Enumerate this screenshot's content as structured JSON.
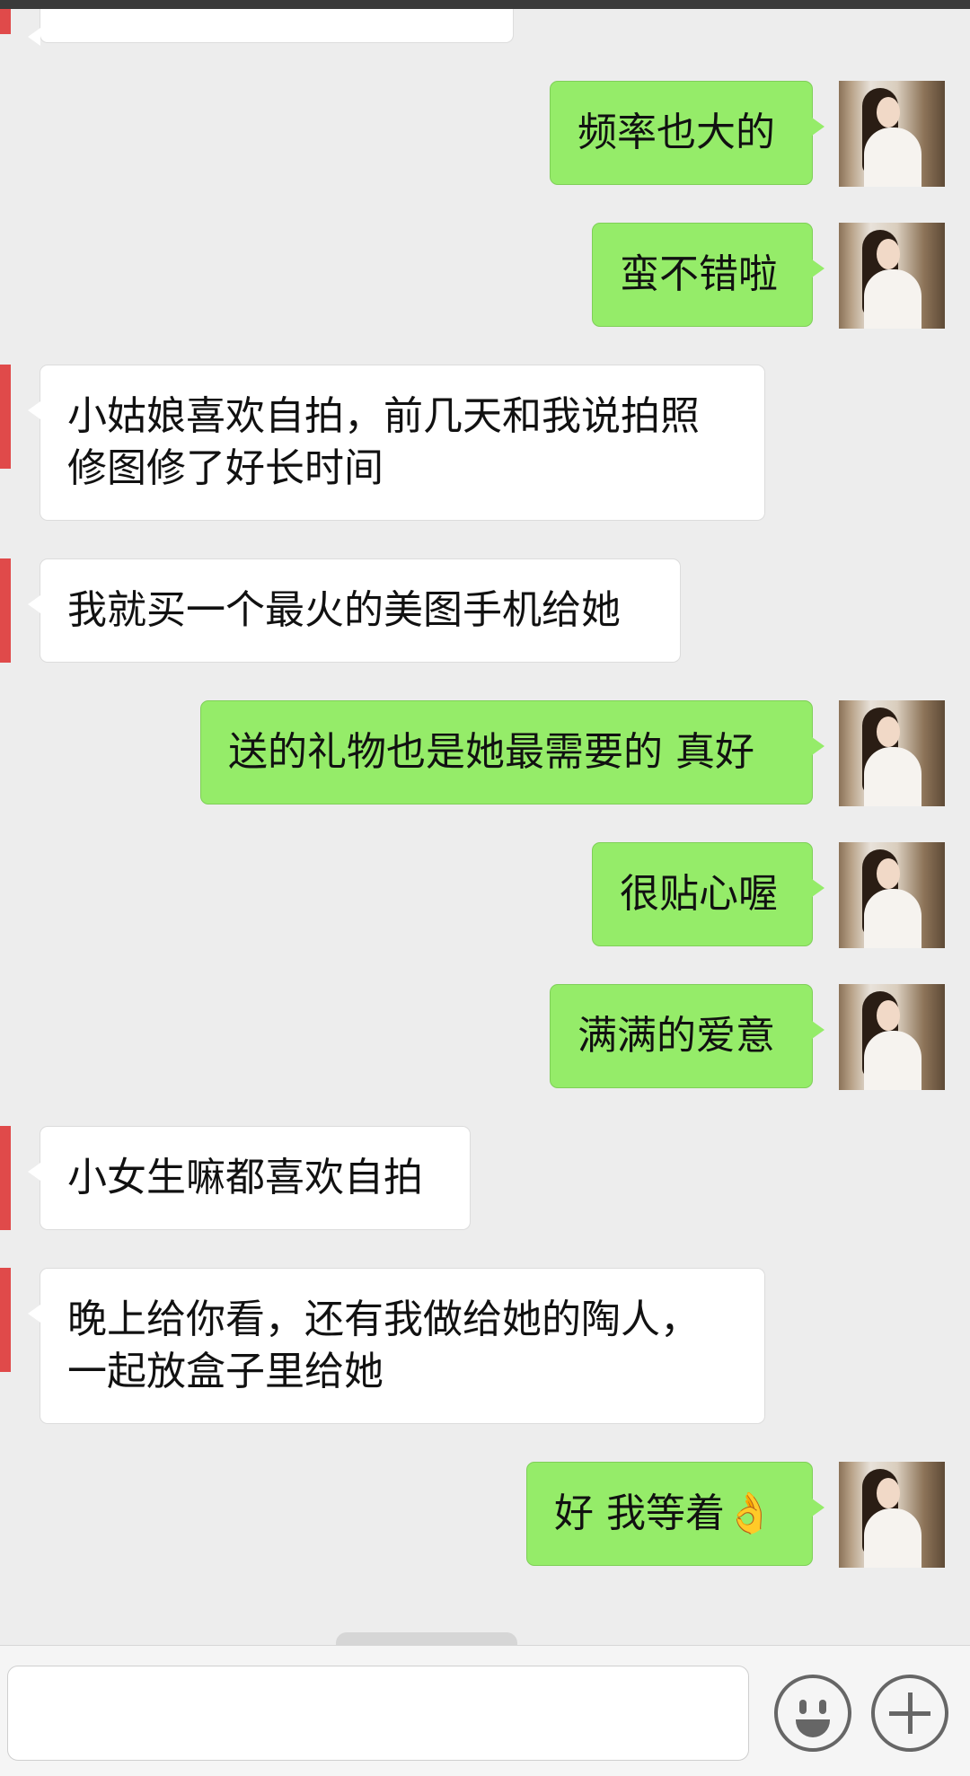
{
  "messages": [
    {
      "side": "out",
      "text": "频率也大的"
    },
    {
      "side": "out",
      "text": "蛮不错啦"
    },
    {
      "side": "in",
      "text": "小姑娘喜欢自拍，前几天和我说拍照\n修图修了好长时间"
    },
    {
      "side": "in",
      "text": "我就买一个最火的美图手机给她"
    },
    {
      "side": "out",
      "text": "送的礼物也是她最需要的 真好"
    },
    {
      "side": "out",
      "text": "很贴心喔"
    },
    {
      "side": "out",
      "text": "满满的爱意"
    },
    {
      "side": "in",
      "text": "小女生嘛都喜欢自拍"
    },
    {
      "side": "in",
      "text": "晚上给你看，还有我做给她的陶人，\n一起放盒子里给她"
    },
    {
      "side": "out",
      "text": "好 我等着👌"
    }
  ],
  "composer": {
    "input_value": "",
    "emoji_icon": "smiley-icon",
    "more_icon": "plus-icon"
  },
  "colors": {
    "outgoing_bubble": "#95ec69",
    "incoming_bubble": "#ffffff",
    "background": "#ededed",
    "unread_marker": "#e04a4a"
  }
}
